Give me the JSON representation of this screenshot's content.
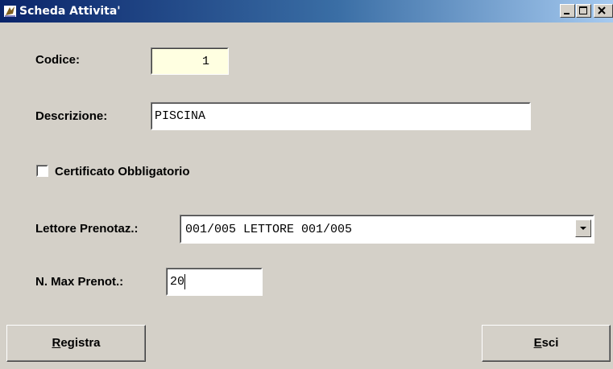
{
  "window": {
    "title": "Scheda Attivita'"
  },
  "form": {
    "codice_label": "Codice:",
    "codice_value": "1",
    "descrizione_label": "Descrizione:",
    "descrizione_value": "PISCINA",
    "certificato_label": "Certificato Obbligatorio",
    "certificato_checked": false,
    "lettore_label": "Lettore Prenotaz.:",
    "lettore_value": "001/005 LETTORE 001/005",
    "max_prenot_label": "N. Max Prenot.:",
    "max_prenot_value": "20"
  },
  "buttons": {
    "registra_accel": "R",
    "registra_rest": "egistra",
    "esci_accel": "E",
    "esci_rest": "sci"
  },
  "colors": {
    "window_bg": "#d4d0c8",
    "titlebar_start": "#0a246a",
    "titlebar_end": "#a6caf0",
    "readonly_field_bg": "#ffffe1",
    "field_bg": "#ffffff"
  },
  "icons": {
    "app": "app-icon",
    "minimize": "minimize-icon",
    "maximize": "maximize-icon",
    "close": "close-icon",
    "dropdown": "dropdown-arrow-icon"
  }
}
